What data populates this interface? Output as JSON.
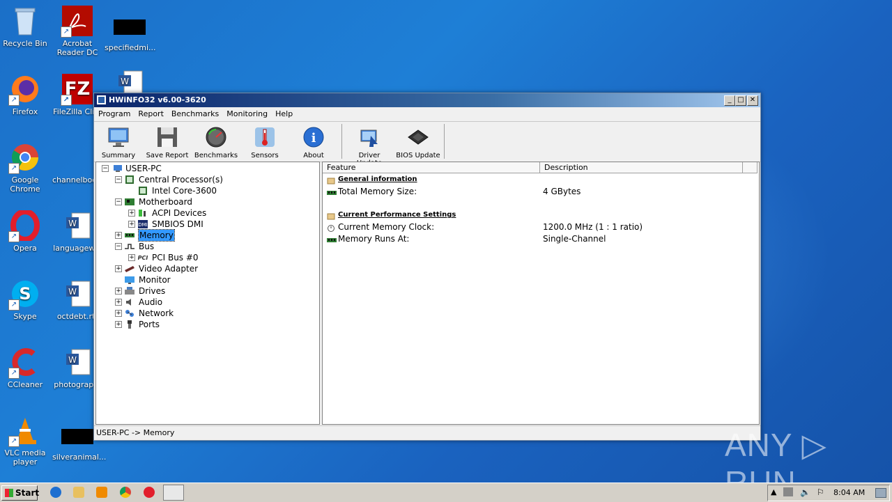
{
  "desktop": {
    "icons": [
      {
        "label": "Recycle Bin"
      },
      {
        "label": "Acrobat Reader DC"
      },
      {
        "label": "specifiedmi..."
      },
      {
        "label": "Firefox"
      },
      {
        "label": "FileZilla Cli..."
      },
      {
        "label": "Google Chrome"
      },
      {
        "label": "channelboo..."
      },
      {
        "label": "Opera"
      },
      {
        "label": "languagew..."
      },
      {
        "label": "Skype"
      },
      {
        "label": "octdebt.rtf"
      },
      {
        "label": "CCleaner"
      },
      {
        "label": "photograp..."
      },
      {
        "label": "VLC media player"
      },
      {
        "label": "silveranimal..."
      }
    ]
  },
  "window": {
    "title": "HWiNFO32 v6.00-3620",
    "controls": {
      "minimize": "_",
      "maximize": "□",
      "close": "✕"
    },
    "menu": [
      "Program",
      "Report",
      "Benchmarks",
      "Monitoring",
      "Help"
    ],
    "toolbar": [
      {
        "label": "Summary",
        "icon": "monitor-icon"
      },
      {
        "label": "Save Report",
        "icon": "floppy-icon"
      },
      {
        "label": "Benchmarks",
        "icon": "gauge-icon"
      },
      {
        "label": "Sensors",
        "icon": "thermometer-icon"
      },
      {
        "label": "About",
        "icon": "info-icon"
      },
      {
        "label": "Driver Update",
        "icon": "driver-update-icon"
      },
      {
        "label": "BIOS Update",
        "icon": "chip-icon"
      }
    ],
    "tree": [
      {
        "label": "USER-PC"
      },
      {
        "label": "Central Processor(s)"
      },
      {
        "label": "Intel Core-3600"
      },
      {
        "label": "Motherboard"
      },
      {
        "label": "ACPI Devices"
      },
      {
        "label": "SMBIOS DMI"
      },
      {
        "label": "Memory"
      },
      {
        "label": "Bus"
      },
      {
        "label": "PCI Bus #0"
      },
      {
        "label": "Video Adapter"
      },
      {
        "label": "Monitor"
      },
      {
        "label": "Drives"
      },
      {
        "label": "Audio"
      },
      {
        "label": "Network"
      },
      {
        "label": "Ports"
      }
    ],
    "details": {
      "columns": [
        "Feature",
        "Description"
      ],
      "rows": [
        {
          "feature": "General information",
          "value": ""
        },
        {
          "feature": "Total Memory Size:",
          "value": "4 GBytes"
        },
        {
          "feature": "Current Performance Settings",
          "value": ""
        },
        {
          "feature": "Current Memory Clock:",
          "value": "1200.0 MHz (1 : 1 ratio)"
        },
        {
          "feature": "Memory Runs At:",
          "value": "Single-Channel"
        }
      ]
    },
    "status": "USER-PC -> Memory"
  },
  "taskbar": {
    "start_label": "Start",
    "clock": "8:04 AM"
  },
  "watermark": "ANY ▷ RUN"
}
